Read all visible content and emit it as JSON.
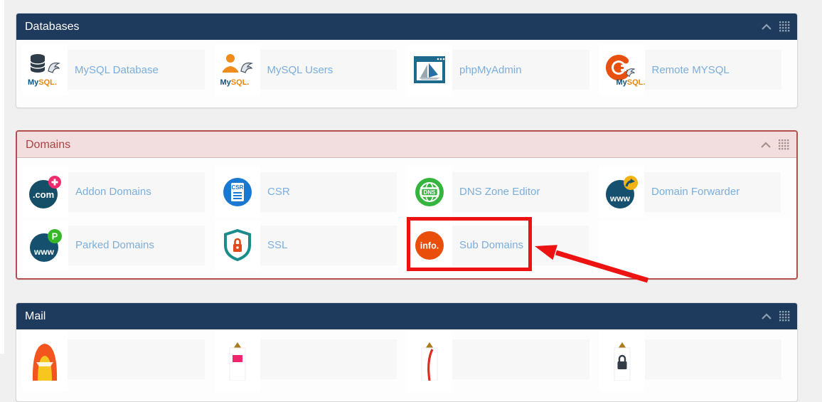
{
  "sections": {
    "databases": {
      "title": "Databases",
      "items": [
        {
          "label": "MySQL Database",
          "icon": "mysql-database-icon"
        },
        {
          "label": "MySQL Users",
          "icon": "mysql-users-icon"
        },
        {
          "label": "phpMyAdmin",
          "icon": "phpmyadmin-icon"
        },
        {
          "label": "Remote MYSQL",
          "icon": "remote-mysql-icon"
        }
      ]
    },
    "domains": {
      "title": "Domains",
      "items": [
        {
          "label": "Addon Domains",
          "icon": "addon-domains-icon"
        },
        {
          "label": "CSR",
          "icon": "csr-icon"
        },
        {
          "label": "DNS Zone Editor",
          "icon": "dns-zone-editor-icon"
        },
        {
          "label": "Domain Forwarder",
          "icon": "domain-forwarder-icon"
        },
        {
          "label": "Parked Domains",
          "icon": "parked-domains-icon"
        },
        {
          "label": "SSL",
          "icon": "ssl-icon"
        },
        {
          "label": "Sub Domains",
          "icon": "sub-domains-icon"
        }
      ]
    },
    "mail": {
      "title": "Mail"
    }
  },
  "icon_text": {
    "mysql_my": "My",
    "mysql_sql": "SQL.",
    "addon_com": ".com",
    "csr": "CSR",
    "dns": "DNS",
    "www": "www",
    "parked_badge": "P",
    "info": "info."
  },
  "annotation": {
    "marker": "red-box-with-arrow",
    "highlighted_item": "Sub Domains",
    "color": "#ee1313"
  },
  "colors": {
    "header_navy": "#1e3a5c",
    "header_navy_text": "#ffffff",
    "danger_bg": "#f2dede",
    "danger_text": "#a94442",
    "danger_border": "#b25050",
    "item_link": "#7aaedd",
    "highlight": "#ee1313"
  }
}
